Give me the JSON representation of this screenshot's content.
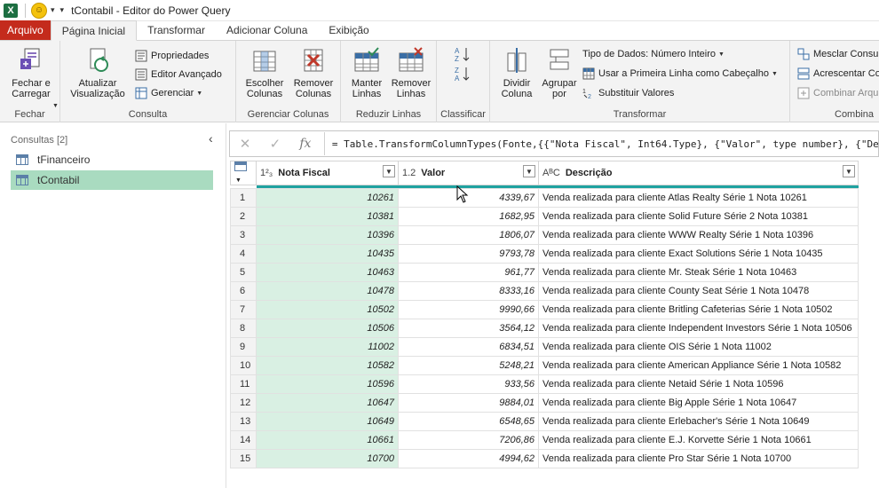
{
  "window": {
    "title": "tContabil - Editor do Power Query",
    "app_icon": "excel-icon"
  },
  "tabs": [
    {
      "label": "Arquivo"
    },
    {
      "label": "Página Inicial"
    },
    {
      "label": "Transformar"
    },
    {
      "label": "Adicionar Coluna"
    },
    {
      "label": "Exibição"
    }
  ],
  "ribbon": {
    "fechar": {
      "label": "Fechar",
      "close_load": "Fechar e\nCarregar"
    },
    "consulta": {
      "label": "Consulta",
      "refresh": "Atualizar\nVisualização",
      "properties": "Propriedades",
      "advanced_editor": "Editor Avançado",
      "manage": "Gerenciar"
    },
    "gerenciar_colunas": {
      "label": "Gerenciar Colunas",
      "choose": "Escolher\nColunas",
      "remove": "Remover\nColunas"
    },
    "reduzir_linhas": {
      "label": "Reduzir Linhas",
      "keep": "Manter\nLinhas",
      "remove": "Remover\nLinhas"
    },
    "classificar": {
      "label": "Classificar"
    },
    "transformar": {
      "label": "Transformar",
      "split": "Dividir\nColuna",
      "group": "Agrupar\npor",
      "data_type": "Tipo de Dados: Número Inteiro",
      "first_row_header": "Usar a Primeira Linha como Cabeçalho",
      "replace_values": "Substituir Valores"
    },
    "combinar": {
      "label": "Combina",
      "merge": "Mesclar Consu",
      "append": "Acrescentar Co",
      "combine_files": "Combinar Arqu"
    }
  },
  "queries": {
    "header": "Consultas [2]",
    "items": [
      {
        "label": "tFinanceiro"
      },
      {
        "label": "tContabil"
      }
    ]
  },
  "formula": {
    "text": "= Table.TransformColumnTypes(Fonte,{{\"Nota Fiscal\", Int64.Type}, {\"Valor\", type number}, {\"De"
  },
  "table": {
    "columns": [
      {
        "type_icon": "1²₃",
        "name": "Nota Fiscal"
      },
      {
        "type_icon": "1.2",
        "name": "Valor"
      },
      {
        "type_icon": "AᴮC",
        "name": "Descrição"
      }
    ],
    "rows": [
      {
        "n": "1",
        "nf": "10261",
        "valor": "4339,67",
        "desc": "Venda realizada para cliente Atlas Realty Série 1 Nota 10261"
      },
      {
        "n": "2",
        "nf": "10381",
        "valor": "1682,95",
        "desc": "Venda realizada para cliente Solid Future Série 2 Nota 10381"
      },
      {
        "n": "3",
        "nf": "10396",
        "valor": "1806,07",
        "desc": "Venda realizada para cliente WWW Realty Série 1 Nota 10396"
      },
      {
        "n": "4",
        "nf": "10435",
        "valor": "9793,78",
        "desc": "Venda realizada para cliente Exact Solutions Série 1 Nota 10435"
      },
      {
        "n": "5",
        "nf": "10463",
        "valor": "961,77",
        "desc": "Venda realizada para cliente Mr. Steak Série 1 Nota 10463"
      },
      {
        "n": "6",
        "nf": "10478",
        "valor": "8333,16",
        "desc": "Venda realizada para cliente County Seat Série 1 Nota 10478"
      },
      {
        "n": "7",
        "nf": "10502",
        "valor": "9990,66",
        "desc": "Venda realizada para cliente Britling Cafeterias Série 1 Nota 10502"
      },
      {
        "n": "8",
        "nf": "10506",
        "valor": "3564,12",
        "desc": "Venda realizada para cliente Independent Investors Série 1 Nota 10506"
      },
      {
        "n": "9",
        "nf": "11002",
        "valor": "6834,51",
        "desc": "Venda realizada para cliente OIS Série 1 Nota 11002"
      },
      {
        "n": "10",
        "nf": "10582",
        "valor": "5248,21",
        "desc": "Venda realizada para cliente American Appliance Série 1 Nota 10582"
      },
      {
        "n": "11",
        "nf": "10596",
        "valor": "933,56",
        "desc": "Venda realizada para cliente Netaid Série 1 Nota 10596"
      },
      {
        "n": "12",
        "nf": "10647",
        "valor": "9884,01",
        "desc": "Venda realizada para cliente Big Apple Série 1 Nota 10647"
      },
      {
        "n": "13",
        "nf": "10649",
        "valor": "6548,65",
        "desc": "Venda realizada para cliente Erlebacher's Série 1 Nota 10649"
      },
      {
        "n": "14",
        "nf": "10661",
        "valor": "7206,86",
        "desc": "Venda realizada para cliente E.J. Korvette Série 1 Nota 10661"
      },
      {
        "n": "15",
        "nf": "10700",
        "valor": "4994,62",
        "desc": "Venda realizada para cliente Pro Star Série 1 Nota 10700"
      }
    ]
  },
  "colors": {
    "accent": "#1fa2a0",
    "selected_query": "#a9dbc0",
    "file_tab": "#c42b1c",
    "selected_column": "#d9f0e3"
  }
}
